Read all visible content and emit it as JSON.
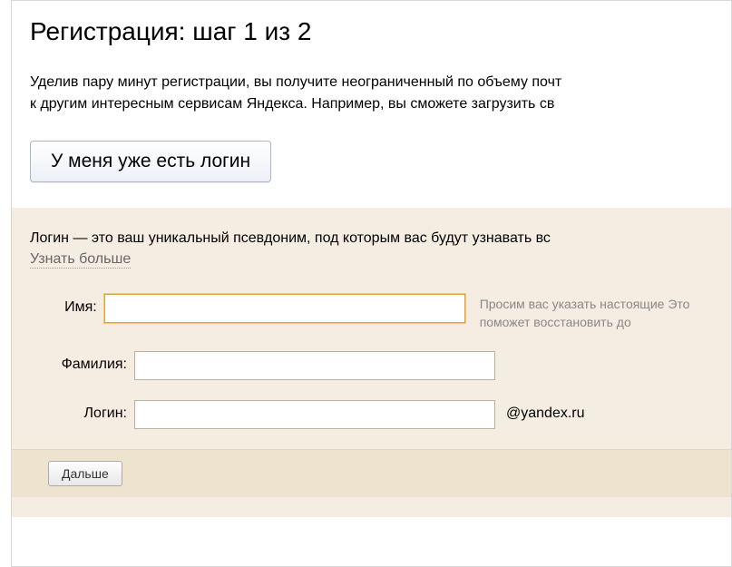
{
  "title": "Регистрация: шаг 1 из 2",
  "intro": "Уделив пару минут регистрации, вы получите неограниченный по объему почт\nк другим интересным сервисам Яндекса. Например, вы сможете загрузить св",
  "have_login_button": "У меня уже есть логин",
  "form": {
    "login_description": "Логин — это ваш уникальный псевдоним, под которым вас будут узнавать вс",
    "learn_more": "Узнать больше",
    "fields": {
      "firstname": {
        "label": "Имя:",
        "value": "",
        "hint": "Просим вас указать настоящие\nЭто поможет восстановить до"
      },
      "lastname": {
        "label": "Фамилия:",
        "value": ""
      },
      "login": {
        "label": "Логин:",
        "value": "",
        "suffix": "@yandex.ru"
      }
    },
    "submit": "Дальше"
  }
}
